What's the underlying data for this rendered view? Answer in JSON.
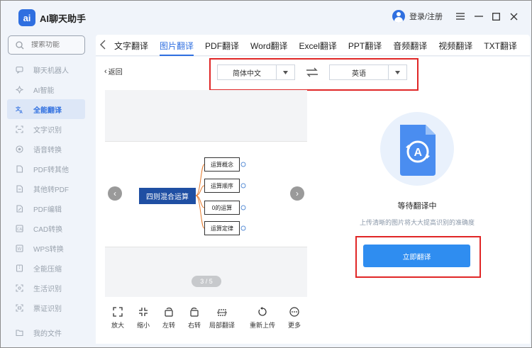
{
  "app": {
    "name": "AI聊天助手",
    "logo_text": "ai"
  },
  "search": {
    "placeholder": "搜索功能"
  },
  "sidebar": {
    "items": [
      {
        "label": "聊天机器人",
        "icon": "chat-icon"
      },
      {
        "label": "AI智能",
        "icon": "ai-icon"
      },
      {
        "label": "全能翻译",
        "icon": "translate-icon",
        "active": true
      },
      {
        "label": "文字识别",
        "icon": "ocr-icon"
      },
      {
        "label": "语音转换",
        "icon": "voice-icon"
      },
      {
        "label": "PDF转其他",
        "icon": "pdf-convert-icon"
      },
      {
        "label": "其他转PDF",
        "icon": "to-pdf-icon"
      },
      {
        "label": "PDF编辑",
        "icon": "pdf-edit-icon"
      },
      {
        "label": "CAD转换",
        "icon": "cad-icon"
      },
      {
        "label": "WPS转换",
        "icon": "wps-icon"
      },
      {
        "label": "全能压缩",
        "icon": "compress-icon"
      },
      {
        "label": "生活识别",
        "icon": "life-icon"
      },
      {
        "label": "票证识别",
        "icon": "ticket-icon"
      }
    ],
    "bottom": {
      "label": "我的文件",
      "icon": "folder-icon"
    }
  },
  "header": {
    "login_label": "登录/注册"
  },
  "tabs": [
    "文字翻译",
    "图片翻译",
    "PDF翻译",
    "Word翻译",
    "Excel翻译",
    "PPT翻译",
    "音频翻译",
    "视频翻译",
    "TXT翻译"
  ],
  "active_tab": "图片翻译",
  "back_label": "返回",
  "lang": {
    "source": "简体中文",
    "target": "英语"
  },
  "mindmap": {
    "root": "四则混合运算",
    "nodes": [
      "运算概念",
      "运算顺序",
      "0的运算",
      "运算定律"
    ]
  },
  "pager": "3 / 5",
  "tools": [
    "放大",
    "缩小",
    "左转",
    "右转",
    "局部翻译",
    "重新上传",
    "更多"
  ],
  "status": {
    "title": "等待翻译中",
    "hint": "上传清晰的图片将大大提高识别的准确度",
    "button": "立即翻译"
  },
  "colors": {
    "accent": "#2f6fe0",
    "button": "#2f8df0",
    "highlight": "#e02626",
    "root_node": "#1f4fa3"
  }
}
